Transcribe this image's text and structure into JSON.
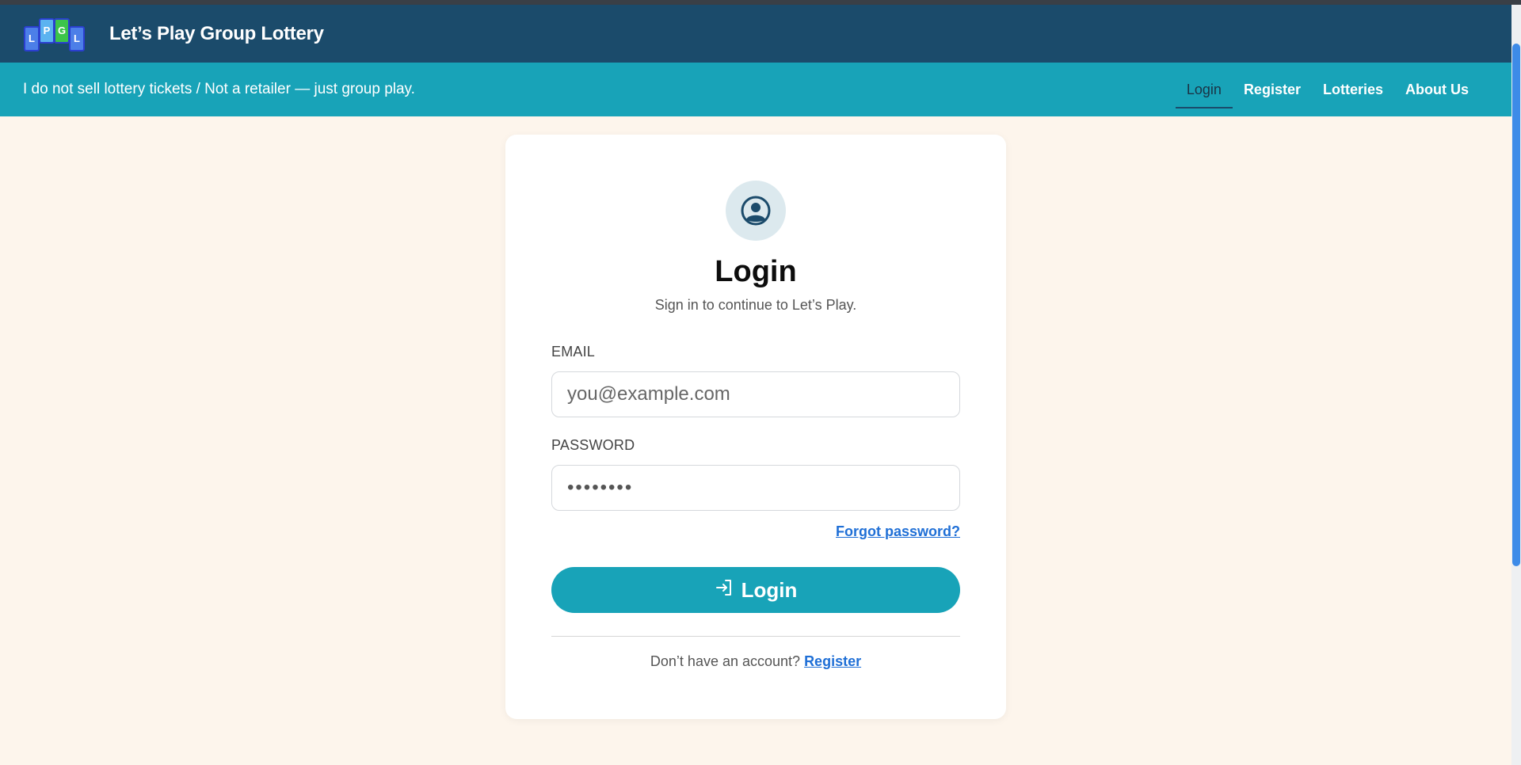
{
  "header": {
    "logo_letters": [
      "L",
      "P",
      "G",
      "L"
    ],
    "brand": "Let’s Play Group Lottery"
  },
  "subbar": {
    "tagline": "I do not sell lottery tickets / Not a retailer — just group play.",
    "nav": [
      {
        "label": "Login",
        "active": true
      },
      {
        "label": "Register",
        "active": false
      },
      {
        "label": "Lotteries",
        "active": false
      },
      {
        "label": "About Us",
        "active": false
      }
    ]
  },
  "card": {
    "icon": "user-circle-icon",
    "title": "Login",
    "subtitle": "Sign in to continue to Let’s Play.",
    "email_label": "EMAIL",
    "email_placeholder": "you@example.com",
    "password_label": "PASSWORD",
    "password_value": "••••••••",
    "forgot_label": "Forgot password?",
    "login_button_label": "Login",
    "login_button_icon": "sign-in-icon",
    "footer_text": "Don’t have an account?",
    "footer_link": "Register"
  },
  "colors": {
    "header_bg": "#1b4b6b",
    "subbar_bg": "#18a3b8",
    "page_bg": "#fdf5ec",
    "accent": "#18a3b8",
    "link": "#1f6fd6"
  }
}
